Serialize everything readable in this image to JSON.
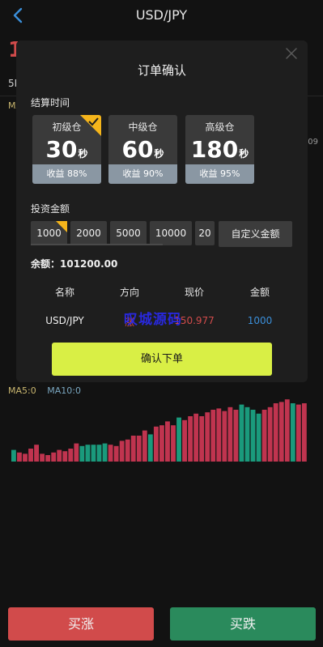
{
  "header": {
    "title": "USD/JPY",
    "back_icon": "chevron-left-icon"
  },
  "background": {
    "price_partial": "1",
    "tab_partial": "5M",
    "ma_partial": "MA",
    "axis_partial": ".09",
    "ma5": "MA5:0",
    "ma10": "MA10:0",
    "volume_colors": {
      "up": "#c0344f",
      "down": "#1a9a7c"
    },
    "volumes": [
      {
        "v": 0.18,
        "c": "down"
      },
      {
        "v": 0.14,
        "c": "up"
      },
      {
        "v": 0.12,
        "c": "up"
      },
      {
        "v": 0.2,
        "c": "up"
      },
      {
        "v": 0.26,
        "c": "up"
      },
      {
        "v": 0.12,
        "c": "up"
      },
      {
        "v": 0.1,
        "c": "up"
      },
      {
        "v": 0.14,
        "c": "up"
      },
      {
        "v": 0.18,
        "c": "up"
      },
      {
        "v": 0.16,
        "c": "up"
      },
      {
        "v": 0.2,
        "c": "up"
      },
      {
        "v": 0.28,
        "c": "up"
      },
      {
        "v": 0.24,
        "c": "down"
      },
      {
        "v": 0.26,
        "c": "down"
      },
      {
        "v": 0.26,
        "c": "down"
      },
      {
        "v": 0.26,
        "c": "down"
      },
      {
        "v": 0.28,
        "c": "down"
      },
      {
        "v": 0.26,
        "c": "up"
      },
      {
        "v": 0.24,
        "c": "up"
      },
      {
        "v": 0.32,
        "c": "up"
      },
      {
        "v": 0.34,
        "c": "up"
      },
      {
        "v": 0.4,
        "c": "up"
      },
      {
        "v": 0.4,
        "c": "up"
      },
      {
        "v": 0.48,
        "c": "up"
      },
      {
        "v": 0.42,
        "c": "down"
      },
      {
        "v": 0.54,
        "c": "up"
      },
      {
        "v": 0.56,
        "c": "up"
      },
      {
        "v": 0.62,
        "c": "up"
      },
      {
        "v": 0.56,
        "c": "up"
      },
      {
        "v": 0.68,
        "c": "down"
      },
      {
        "v": 0.64,
        "c": "up"
      },
      {
        "v": 0.7,
        "c": "up"
      },
      {
        "v": 0.74,
        "c": "up"
      },
      {
        "v": 0.7,
        "c": "up"
      },
      {
        "v": 0.76,
        "c": "up"
      },
      {
        "v": 0.8,
        "c": "up"
      },
      {
        "v": 0.82,
        "c": "up"
      },
      {
        "v": 0.78,
        "c": "up"
      },
      {
        "v": 0.84,
        "c": "up"
      },
      {
        "v": 0.8,
        "c": "up"
      },
      {
        "v": 0.88,
        "c": "down"
      },
      {
        "v": 0.84,
        "c": "down"
      },
      {
        "v": 0.8,
        "c": "down"
      },
      {
        "v": 0.74,
        "c": "down"
      },
      {
        "v": 0.8,
        "c": "up"
      },
      {
        "v": 0.84,
        "c": "up"
      },
      {
        "v": 0.9,
        "c": "up"
      },
      {
        "v": 0.92,
        "c": "up"
      },
      {
        "v": 0.96,
        "c": "up"
      },
      {
        "v": 0.9,
        "c": "down"
      },
      {
        "v": 0.88,
        "c": "up"
      },
      {
        "v": 0.9,
        "c": "up"
      }
    ]
  },
  "modal": {
    "title": "订单确认",
    "close_icon": "close-icon",
    "settle_label": "结算时间",
    "periods": [
      {
        "name": "初级仓",
        "num": "30",
        "unit": "秒",
        "return": "收益 88%",
        "selected": true
      },
      {
        "name": "中级仓",
        "num": "60",
        "unit": "秒",
        "return": "收益 90%",
        "selected": false
      },
      {
        "name": "高级仓",
        "num": "180",
        "unit": "秒",
        "return": "收益 95%",
        "selected": false
      }
    ],
    "amount_label": "投资金额",
    "amounts": [
      {
        "label": "1000",
        "selected": true
      },
      {
        "label": "2000",
        "selected": false
      },
      {
        "label": "5000",
        "selected": false
      },
      {
        "label": "10000",
        "selected": false
      },
      {
        "label": "20",
        "selected": false
      }
    ],
    "custom_amount": "自定义金额",
    "balance": "余额：101200.00",
    "table": {
      "headers": [
        "名称",
        "方向",
        "现价",
        "金额"
      ],
      "row": {
        "name": "USD/JPY",
        "direction": "涨",
        "price": "150.977",
        "amount": "1000"
      }
    },
    "watermark": "叹城源码",
    "confirm": "确认下单",
    "accent": "#f5b51b",
    "confirm_color": "#d9ef45"
  },
  "actions": {
    "buy_up": "买涨",
    "buy_down": "买跌"
  }
}
